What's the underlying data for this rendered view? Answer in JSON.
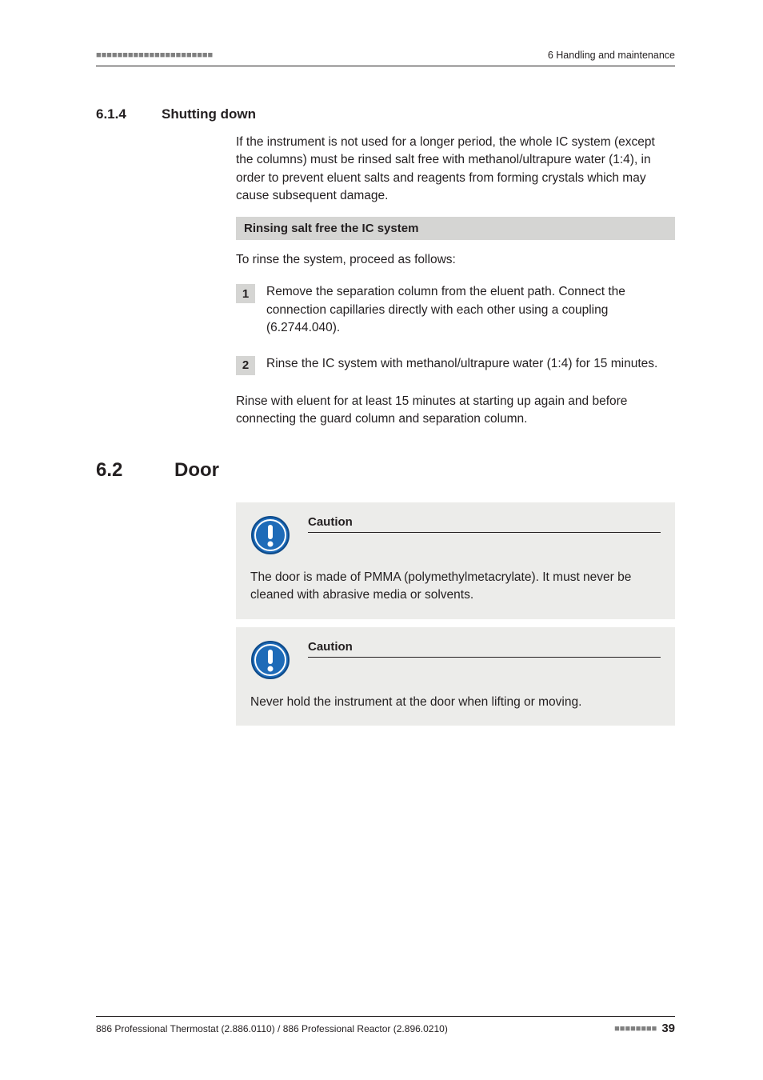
{
  "header": {
    "marker": "■■■■■■■■■■■■■■■■■■■■■■",
    "right": "6 Handling and maintenance"
  },
  "section614": {
    "num": "6.1.4",
    "title": "Shutting down",
    "intro": "If the instrument is not used for a longer period, the whole IC system (except the columns) must be rinsed salt free with methanol/ultrapure water (1:4), in order to prevent eluent salts and reagents from forming crystals which may cause subsequent damage.",
    "greybar": "Rinsing salt free the IC system",
    "lead": "To rinse the system, proceed as follows:",
    "steps": [
      {
        "n": "1",
        "t": "Remove the separation column from the eluent path. Connect the connection capillaries directly with each other using a coupling (6.2744.040)."
      },
      {
        "n": "2",
        "t": "Rinse the IC system with methanol/ultrapure water (1:4) for 15 minutes."
      }
    ],
    "outro": "Rinse with eluent for at least 15 minutes at starting up again and before connecting the guard column and separation column."
  },
  "section62": {
    "num": "6.2",
    "title": "Door",
    "cautions": [
      {
        "label": "Caution",
        "text": "The door is made of PMMA (polymethylmetacrylate). It must never be cleaned with abrasive media or solvents."
      },
      {
        "label": "Caution",
        "text": "Never hold the instrument at the door when lifting or moving."
      }
    ]
  },
  "footer": {
    "left": "886 Professional Thermostat (2.886.0110) / 886 Professional Reactor (2.896.0210)",
    "marker": "■■■■■■■■",
    "page": "39"
  }
}
